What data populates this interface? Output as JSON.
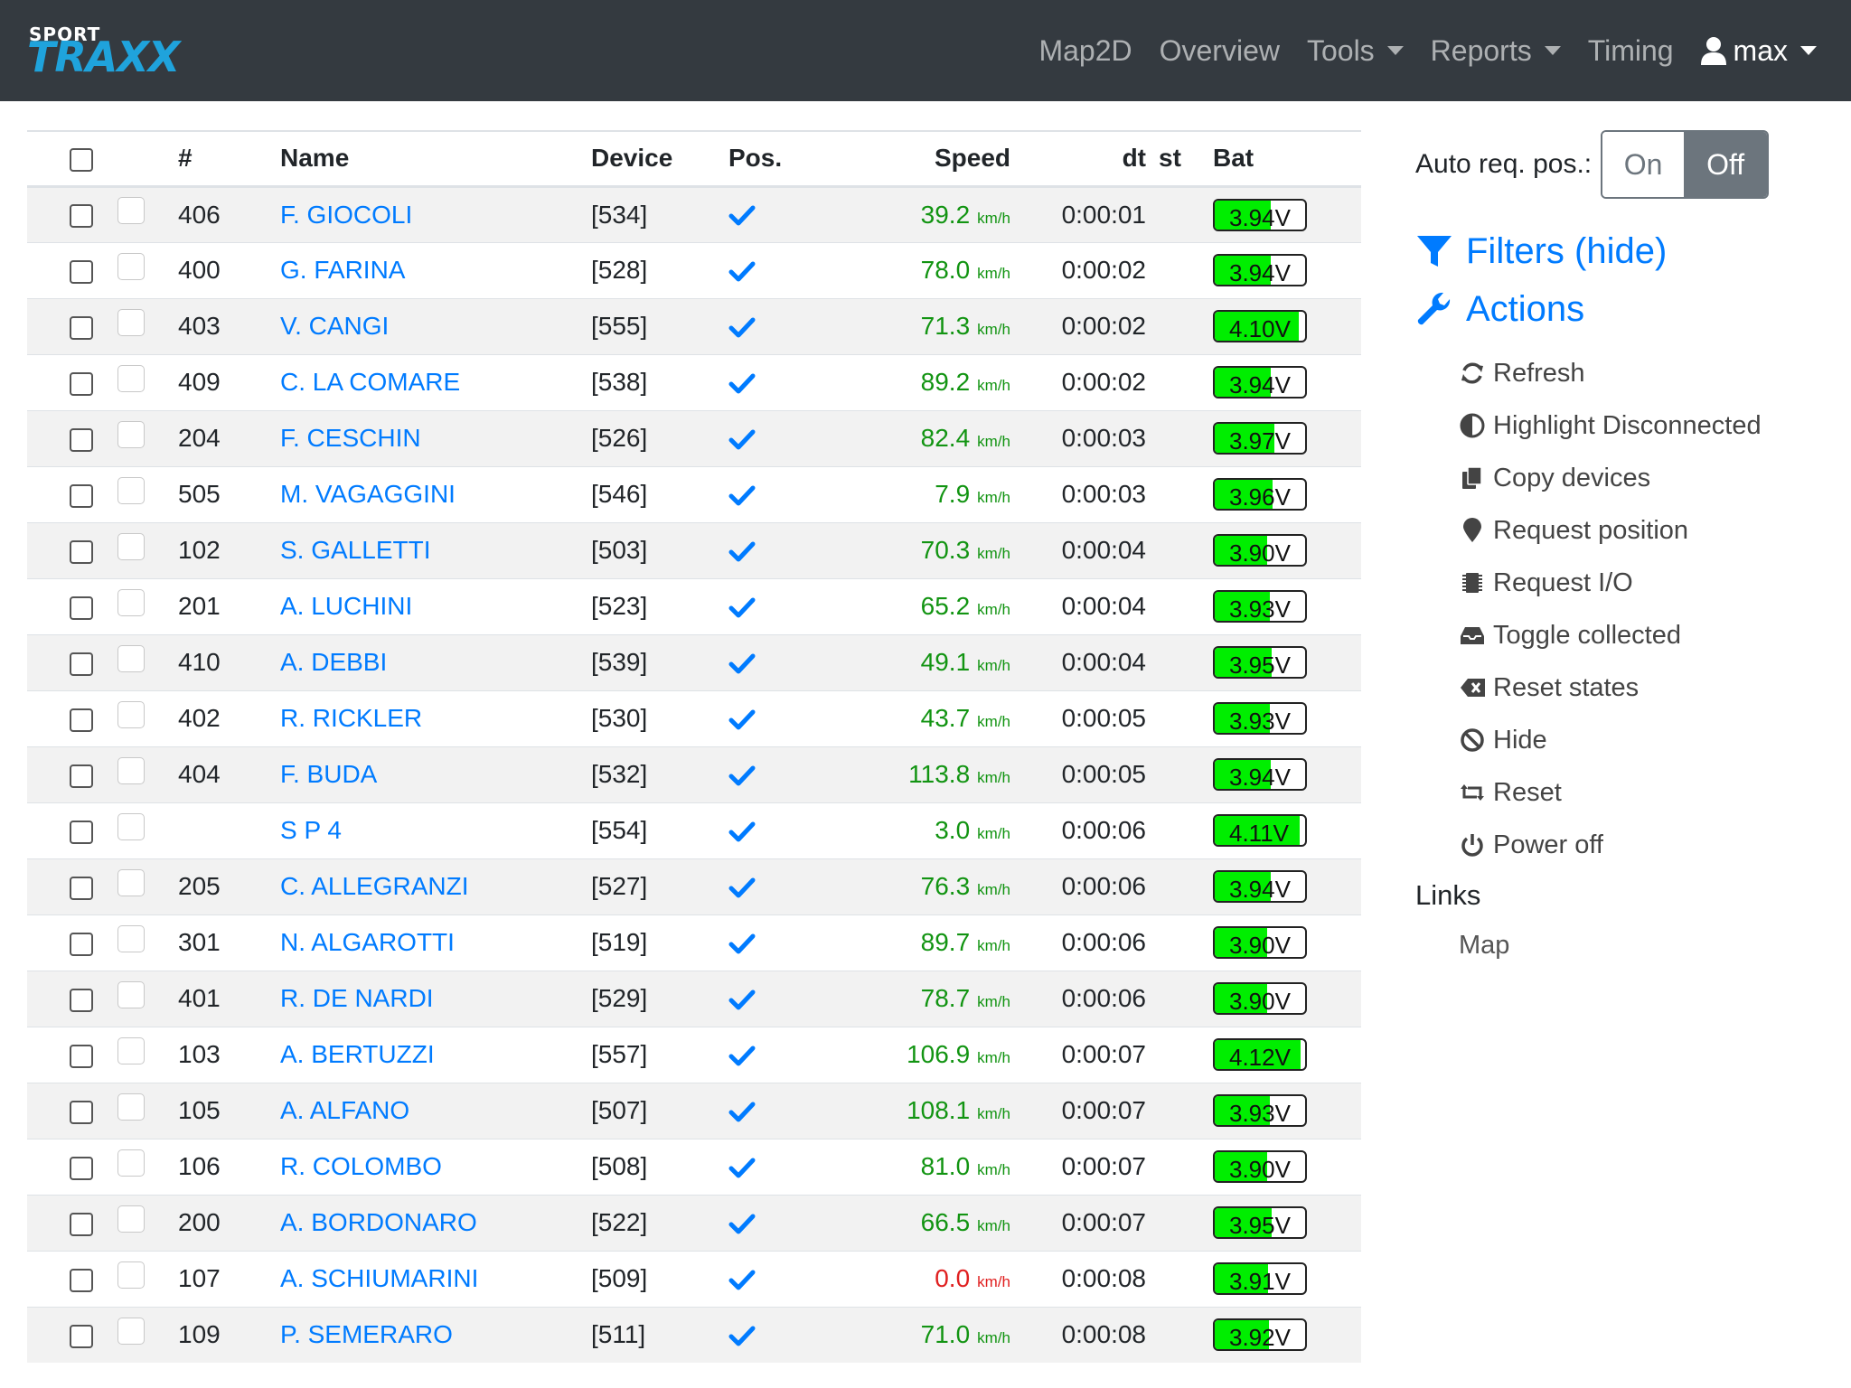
{
  "brand": {
    "top": "SPORT",
    "main": "TRAXX"
  },
  "nav": {
    "map2d": "Map2D",
    "overview": "Overview",
    "tools": "Tools",
    "reports": "Reports",
    "timing": "Timing",
    "user": "max"
  },
  "table": {
    "headers": {
      "num": "#",
      "name": "Name",
      "device": "Device",
      "pos": "Pos.",
      "speed": "Speed",
      "dt": "dt",
      "st": "st",
      "bat": "Bat"
    },
    "speed_unit": "km/h",
    "rows": [
      {
        "num": "406",
        "name": "F. GIOCOLI",
        "device": "[534]",
        "speed": "39.2",
        "dt": "0:00:01",
        "bat": "3.94V",
        "bat_level": 0.62
      },
      {
        "num": "400",
        "name": "G. FARINA",
        "device": "[528]",
        "speed": "78.0",
        "dt": "0:00:02",
        "bat": "3.94V",
        "bat_level": 0.62
      },
      {
        "num": "403",
        "name": "V. CANGI",
        "device": "[555]",
        "speed": "71.3",
        "dt": "0:00:02",
        "bat": "4.10V",
        "bat_level": 0.93
      },
      {
        "num": "409",
        "name": "C. LA COMARE",
        "device": "[538]",
        "speed": "89.2",
        "dt": "0:00:02",
        "bat": "3.94V",
        "bat_level": 0.62
      },
      {
        "num": "204",
        "name": "F. CESCHIN",
        "device": "[526]",
        "speed": "82.4",
        "dt": "0:00:03",
        "bat": "3.97V",
        "bat_level": 0.66
      },
      {
        "num": "505",
        "name": "M. VAGAGGINI",
        "device": "[546]",
        "speed": "7.9",
        "dt": "0:00:03",
        "bat": "3.96V",
        "bat_level": 0.64
      },
      {
        "num": "102",
        "name": "S. GALLETTI",
        "device": "[503]",
        "speed": "70.3",
        "dt": "0:00:04",
        "bat": "3.90V",
        "bat_level": 0.58
      },
      {
        "num": "201",
        "name": "A. LUCHINI",
        "device": "[523]",
        "speed": "65.2",
        "dt": "0:00:04",
        "bat": "3.93V",
        "bat_level": 0.61
      },
      {
        "num": "410",
        "name": "A. DEBBI",
        "device": "[539]",
        "speed": "49.1",
        "dt": "0:00:04",
        "bat": "3.95V",
        "bat_level": 0.63
      },
      {
        "num": "402",
        "name": "R. RICKLER",
        "device": "[530]",
        "speed": "43.7",
        "dt": "0:00:05",
        "bat": "3.93V",
        "bat_level": 0.61
      },
      {
        "num": "404",
        "name": "F. BUDA",
        "device": "[532]",
        "speed": "113.8",
        "dt": "0:00:05",
        "bat": "3.94V",
        "bat_level": 0.62
      },
      {
        "num": "",
        "name": "S P 4",
        "device": "[554]",
        "speed": "3.0",
        "dt": "0:00:06",
        "bat": "4.11V",
        "bat_level": 0.94
      },
      {
        "num": "205",
        "name": "C. ALLEGRANZI",
        "device": "[527]",
        "speed": "76.3",
        "dt": "0:00:06",
        "bat": "3.94V",
        "bat_level": 0.62
      },
      {
        "num": "301",
        "name": "N. ALGAROTTI",
        "device": "[519]",
        "speed": "89.7",
        "dt": "0:00:06",
        "bat": "3.90V",
        "bat_level": 0.58
      },
      {
        "num": "401",
        "name": "R. DE NARDI",
        "device": "[529]",
        "speed": "78.7",
        "dt": "0:00:06",
        "bat": "3.90V",
        "bat_level": 0.58
      },
      {
        "num": "103",
        "name": "A. BERTUZZI",
        "device": "[557]",
        "speed": "106.9",
        "dt": "0:00:07",
        "bat": "4.12V",
        "bat_level": 0.95
      },
      {
        "num": "105",
        "name": "A. ALFANO",
        "device": "[507]",
        "speed": "108.1",
        "dt": "0:00:07",
        "bat": "3.93V",
        "bat_level": 0.61
      },
      {
        "num": "106",
        "name": "R. COLOMBO",
        "device": "[508]",
        "speed": "81.0",
        "dt": "0:00:07",
        "bat": "3.90V",
        "bat_level": 0.58
      },
      {
        "num": "200",
        "name": "A. BORDONARO",
        "device": "[522]",
        "speed": "66.5",
        "dt": "0:00:07",
        "bat": "3.95V",
        "bat_level": 0.63
      },
      {
        "num": "107",
        "name": "A. SCHIUMARINI",
        "device": "[509]",
        "speed": "0.0",
        "dt": "0:00:08",
        "bat": "3.91V",
        "bat_level": 0.59
      },
      {
        "num": "109",
        "name": "P. SEMERARO",
        "device": "[511]",
        "speed": "71.0",
        "dt": "0:00:08",
        "bat": "3.92V",
        "bat_level": 0.6
      }
    ]
  },
  "sidebar": {
    "auto_req_label": "Auto req. pos.:",
    "on": "On",
    "off": "Off",
    "filters": "Filters (hide)",
    "actions": "Actions",
    "action_items": [
      {
        "label": "Refresh",
        "icon": "refresh-icon"
      },
      {
        "label": "Highlight Disconnected",
        "icon": "half-circle-icon"
      },
      {
        "label": "Copy devices",
        "icon": "copy-icon"
      },
      {
        "label": "Request position",
        "icon": "map-marker-icon"
      },
      {
        "label": "Request I/O",
        "icon": "chip-icon"
      },
      {
        "label": "Toggle collected",
        "icon": "inbox-icon"
      },
      {
        "label": "Reset states",
        "icon": "backspace-icon"
      },
      {
        "label": "Hide",
        "icon": "ban-icon"
      },
      {
        "label": "Reset",
        "icon": "retweet-icon"
      },
      {
        "label": "Power off",
        "icon": "power-icon"
      }
    ],
    "links": "Links",
    "map_link": "Map"
  },
  "colors": {
    "navbar": "#343a40",
    "link": "#007bff",
    "speed": "#129412",
    "speed_zero": "#e02020",
    "battery": "#00ee00"
  }
}
